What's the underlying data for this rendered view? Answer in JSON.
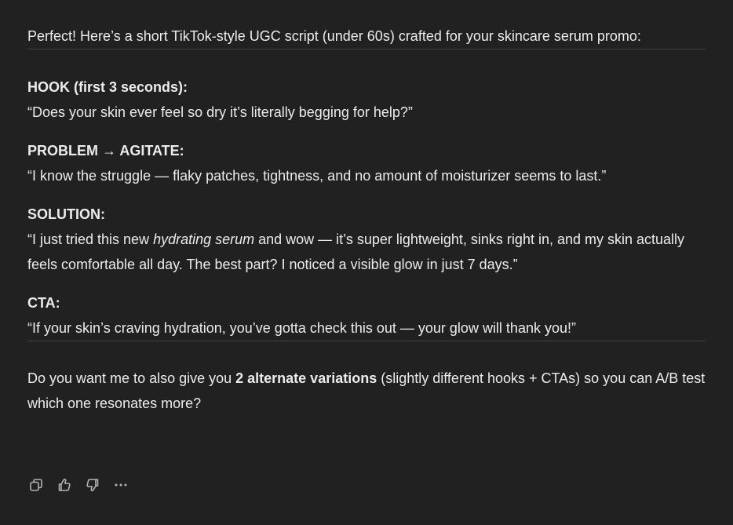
{
  "message": {
    "intro": "Perfect! Here’s a short TikTok-style UGC script (under 60s) crafted for your skincare serum promo:",
    "sections": {
      "hook": {
        "label": "HOOK (first 3 seconds):",
        "text": "“Does your skin ever feel so dry it’s literally begging for help?”"
      },
      "problem": {
        "label": "PROBLEM → AGITATE:",
        "text": "“I know the struggle — flaky patches, tightness, and no amount of moisturizer seems to last.”"
      },
      "solution": {
        "label": "SOLUTION:",
        "text_before": "“I just tried this new ",
        "text_emph": "hydrating serum",
        "text_after": " and wow — it’s super lightweight, sinks right in, and my skin actually feels comfortable all day. The best part? I noticed a visible glow in just 7 days.”"
      },
      "cta": {
        "label": "CTA:",
        "text": "“If your skin’s craving hydration, you’ve gotta check this out — your glow will thank you!”"
      }
    },
    "followup": {
      "before": "Do you want me to also give you ",
      "bold": "2 alternate variations",
      "after": " (slightly different hooks + CTAs) so you can A/B test which one resonates more?"
    }
  },
  "actions": {
    "copy_icon": "copy-icon",
    "like_icon": "thumbs-up-icon",
    "dislike_icon": "thumbs-down-icon",
    "more_icon": "more-horizontal-icon"
  },
  "colors": {
    "background": "#212121",
    "text": "#ececec",
    "divider": "#424242",
    "icon": "#b4b4b4"
  }
}
